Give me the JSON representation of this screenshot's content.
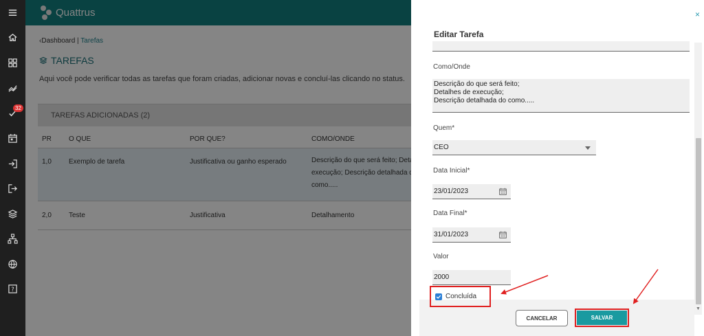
{
  "app": {
    "title": "Quattrus"
  },
  "sidebar": {
    "badge_count": "32"
  },
  "breadcrumb": {
    "home": "Dashboard",
    "separator": "|",
    "current": "Tarefas"
  },
  "page": {
    "title": "TAREFAS",
    "description": "Aqui você pode verificar todas as tarefas que foram criadas, adicionar novas e concluí-las clicando no status."
  },
  "tasks": {
    "header": "TAREFAS ADICIONADAS (2)",
    "columns": [
      "PR",
      "O QUE",
      "POR QUE?",
      "COMO/ONDE"
    ],
    "rows": [
      {
        "pr": "1,0",
        "what": "Exemplo de tarefa",
        "why": "Justificativa ou ganho esperado",
        "how": "Descrição do que será feito; Detalhes de execução; Descrição detalhada do como....."
      },
      {
        "pr": "2,0",
        "what": "Teste",
        "why": "Justificativa",
        "how": "Detalhamento"
      }
    ]
  },
  "edit_panel": {
    "close": "×",
    "title": "Editar Tarefa",
    "how_label": "Como/Onde",
    "how_value": "Descrição do que será feito;\nDetalhes de execução;\nDescrição detalhada do como.....",
    "who_label": "Quem*",
    "who_value": "CEO",
    "start_label": "Data Inicial*",
    "start_value": "23/01/2023",
    "end_label": "Data Final*",
    "end_value": "31/01/2023",
    "value_label": "Valor",
    "value_value": "2000",
    "done_label": "Concluída",
    "done_checked": true,
    "cancel_label": "CANCELAR",
    "save_label": "SALVAR"
  },
  "colors": {
    "primary": "#127f7f",
    "save": "#1a9aa0",
    "annotation": "#e02020",
    "checkbox": "#2b7fd6"
  }
}
